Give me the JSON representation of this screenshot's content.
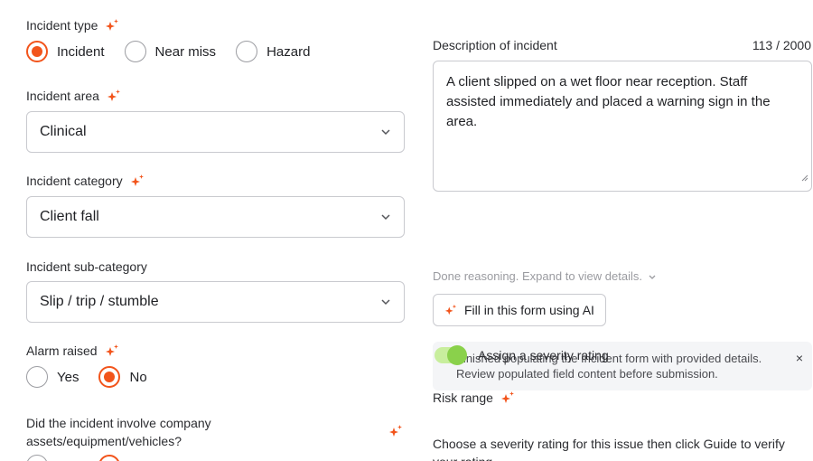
{
  "incident_type": {
    "label": "Incident type",
    "options": [
      "Incident",
      "Near miss",
      "Hazard"
    ],
    "selected": "Incident"
  },
  "incident_area": {
    "label": "Incident area",
    "value": "Clinical"
  },
  "incident_category": {
    "label": "Incident category",
    "value": "Client fall"
  },
  "incident_subcategory": {
    "label": "Incident sub-category",
    "value": "Slip / trip / stumble"
  },
  "alarm_raised": {
    "label": "Alarm raised",
    "options": [
      "Yes",
      "No"
    ],
    "selected": "No"
  },
  "company_assets": {
    "label": "Did the incident involve company assets/equipment/vehicles?"
  },
  "description": {
    "label": "Description of incident",
    "counter": "113 / 2000",
    "value": "A client slipped on a wet floor near reception. Staff assisted immediately and placed a warning sign in the area."
  },
  "ai_notice": {
    "line1": "Finished populating the Incident form with provided details.",
    "line2": "Review populated field content before submission.",
    "close": "×"
  },
  "reasoning": {
    "text": "Done reasoning. Expand to view details."
  },
  "ai_button": {
    "label": "Fill in this form using AI"
  },
  "severity_toggle": {
    "label": "Assign a severity rating",
    "on": true
  },
  "risk_range": {
    "label": "Risk range"
  },
  "severity_help": {
    "text": "Choose a severity rating for this issue then click Guide to verify your rating"
  },
  "colors": {
    "accent": "#f2541b",
    "toggle_on": "#8ad14b",
    "toggle_track": "#c8ee9d"
  }
}
